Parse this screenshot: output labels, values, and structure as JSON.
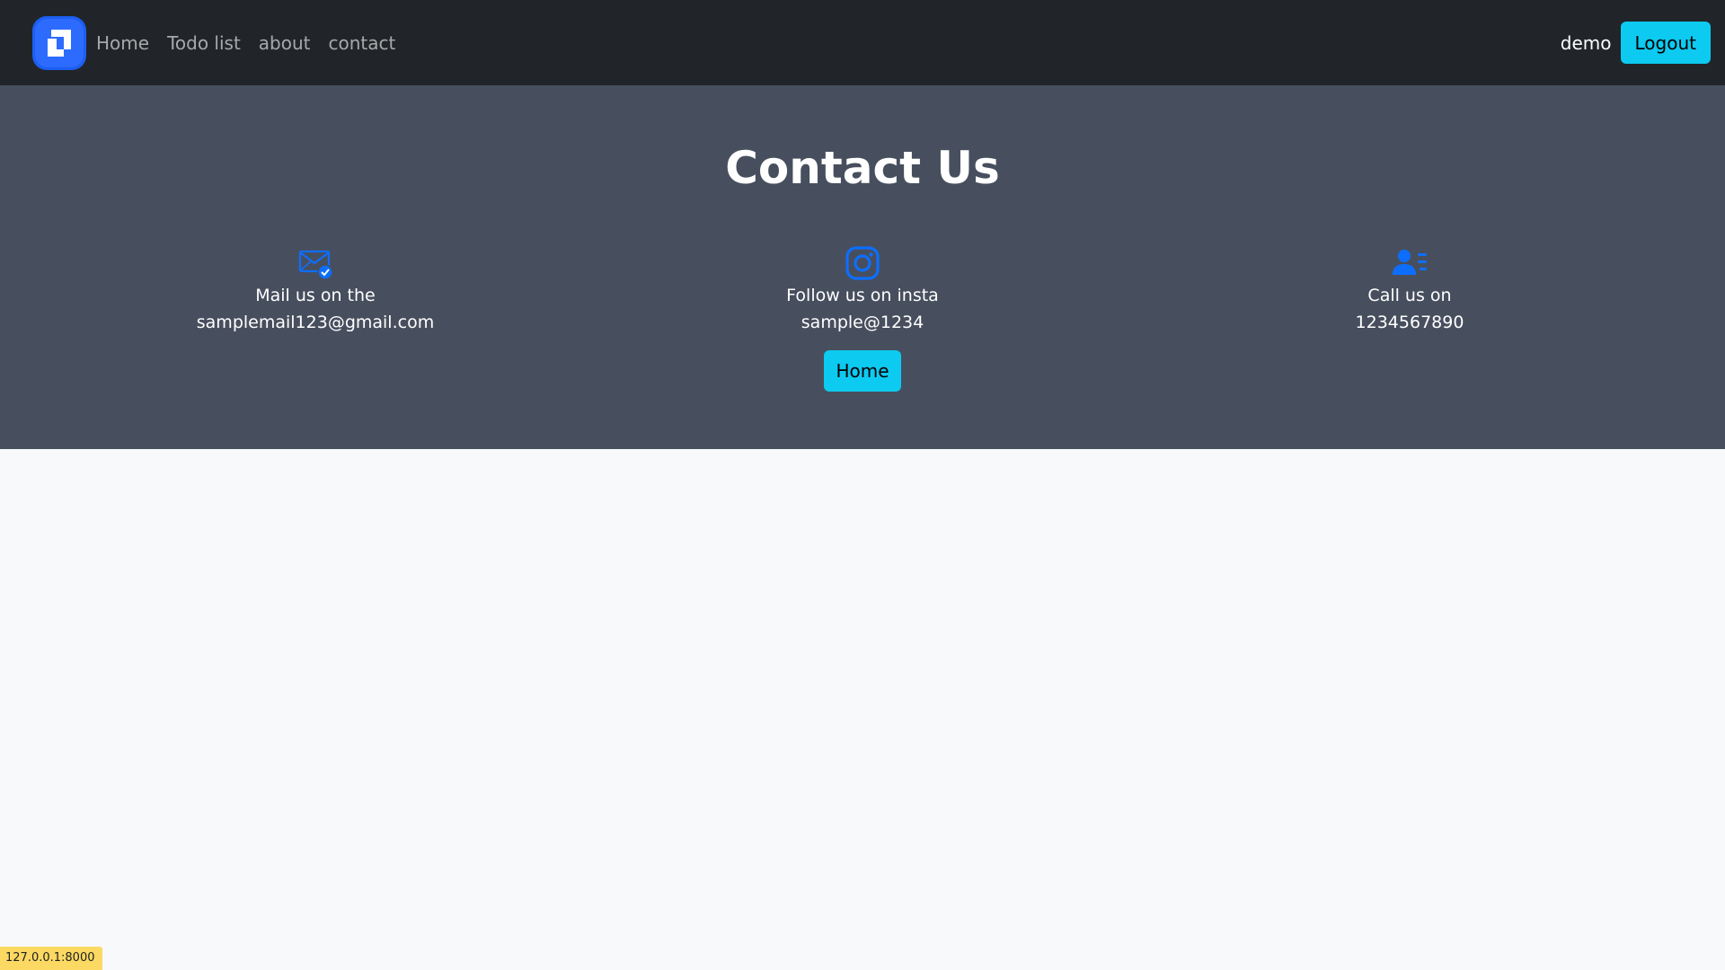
{
  "navbar": {
    "links": [
      {
        "label": "Home"
      },
      {
        "label": "Todo list"
      },
      {
        "label": "about"
      },
      {
        "label": "contact"
      }
    ],
    "username": "demo",
    "logout_label": "Logout"
  },
  "hero": {
    "title": "Contact Us",
    "contacts": [
      {
        "icon": "envelope-check-icon",
        "line1": "Mail us on the",
        "line2": "samplemail123@gmail.com"
      },
      {
        "icon": "instagram-icon",
        "line1": "Follow us on insta",
        "line2": "sample@1234"
      },
      {
        "icon": "person-lines-icon",
        "line1": "Call us on",
        "line2": "1234567890"
      }
    ],
    "home_button_label": "Home"
  },
  "status_bar": {
    "url": "127.0.0.1:8000"
  },
  "colors": {
    "navbar_bg": "#212529",
    "hero_bg": "#474f5e",
    "accent_info": "#0dcaf0",
    "icon_blue": "#0d6efd",
    "page_bg": "#f8f9fa",
    "status_bg": "#fbd962"
  }
}
